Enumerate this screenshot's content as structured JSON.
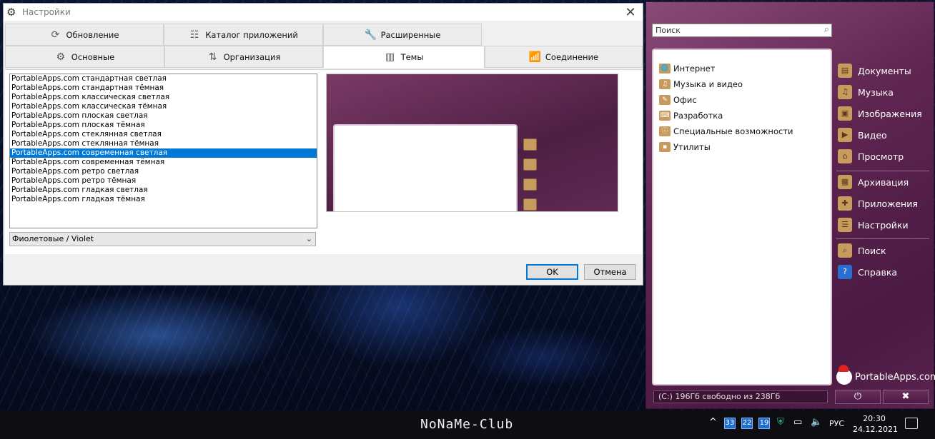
{
  "window": {
    "title": "Настройки",
    "close_glyph": "✕",
    "tabs_row1": [
      {
        "label": "Обновление",
        "icon": "refresh-icon",
        "glyph": "⟳"
      },
      {
        "label": "Каталог приложений",
        "icon": "grid-list-icon",
        "glyph": "☷"
      },
      {
        "label": "Расширенные",
        "icon": "wrench-icon",
        "glyph": "🔧"
      }
    ],
    "tabs_row2": [
      {
        "label": "Основные",
        "icon": "gear-icon",
        "glyph": "⚙"
      },
      {
        "label": "Организация",
        "icon": "sort-icon",
        "glyph": "⇅"
      },
      {
        "label": "Темы",
        "icon": "theme-icon",
        "glyph": "▥"
      },
      {
        "label": "Соединение",
        "icon": "antenna-icon",
        "glyph": "📶"
      }
    ],
    "themes": [
      "PortableApps.com стандартная светлая",
      "PortableApps.com стандартная тёмная",
      "PortableApps.com классическая светлая",
      "PortableApps.com классическая тёмная",
      "PortableApps.com плоская светлая",
      "PortableApps.com плоская тёмная",
      "PortableApps.com стеклянная светлая",
      "PortableApps.com стеклянная тёмная",
      "PortableApps.com современная светлая",
      "PortableApps.com современная тёмная",
      "PortableApps.com ретро светлая",
      "PortableApps.com ретро тёмная",
      "PortableApps.com гладкая светлая",
      "PortableApps.com гладкая тёмная"
    ],
    "selected_theme_index": 8,
    "color_scheme": "Фиолетовые / Violet",
    "ok_label": "OK",
    "cancel_label": "Отмена"
  },
  "menu": {
    "search_placeholder": "Поиск",
    "categories": [
      "Интернет",
      "Музыка и видео",
      "Офис",
      "Разработка",
      "Специальные возможности",
      "Утилиты"
    ],
    "side_items": [
      {
        "label": "Документы",
        "icon": "documents-folder-icon",
        "glyph": "▤"
      },
      {
        "label": "Музыка",
        "icon": "music-folder-icon",
        "glyph": "♫"
      },
      {
        "label": "Изображения",
        "icon": "pictures-folder-icon",
        "glyph": "▣"
      },
      {
        "label": "Видео",
        "icon": "video-folder-icon",
        "glyph": "▶"
      },
      {
        "label": "Просмотр",
        "icon": "explore-folder-icon",
        "glyph": "⌂"
      },
      {
        "label": "Архивация",
        "icon": "backup-icon",
        "glyph": "▦"
      },
      {
        "label": "Приложения",
        "icon": "apps-icon",
        "glyph": "✚"
      },
      {
        "label": "Настройки",
        "icon": "settings-icon",
        "glyph": "☰"
      },
      {
        "label": "Поиск",
        "icon": "search-icon",
        "glyph": "⌕"
      },
      {
        "label": "Справка",
        "icon": "help-icon",
        "glyph": "?"
      }
    ],
    "logo_text": "PortableApps.com",
    "status": "(C:) 196Гб свободно из 238Гб",
    "power_glyph": "⏻",
    "close_glyph": "✖"
  },
  "taskbar": {
    "brand": "NoNaMe-Club",
    "chevron": "^",
    "badges": [
      "33",
      "22",
      "19"
    ],
    "lang": "РУС",
    "time": "20:30",
    "date": "24.12.2021"
  },
  "colors": {
    "accent": "#0078d7",
    "menu_bg": "#5e2550"
  }
}
